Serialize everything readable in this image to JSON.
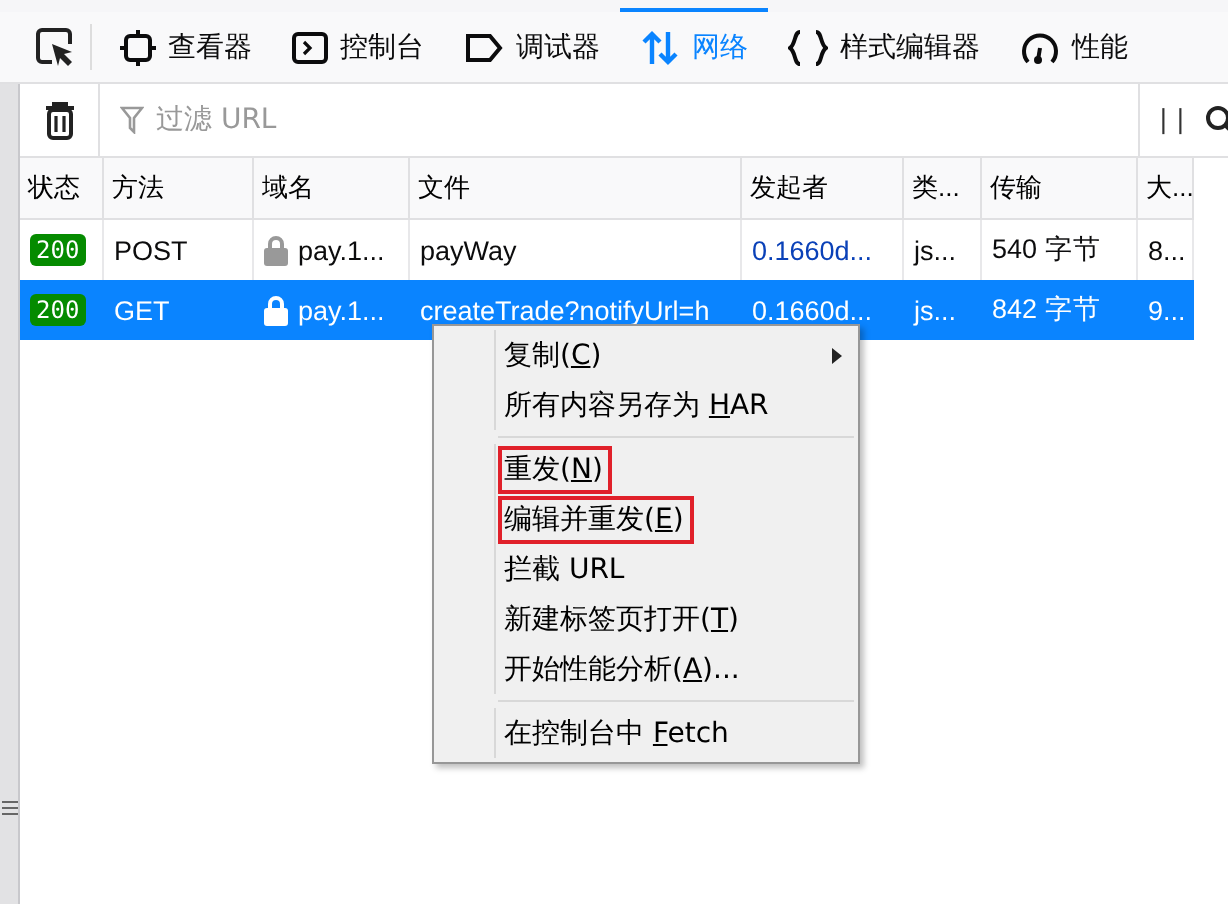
{
  "tabs": [
    {
      "label": "查看器",
      "selected": false
    },
    {
      "label": "控制台",
      "selected": false
    },
    {
      "label": "调试器",
      "selected": false
    },
    {
      "label": "网络",
      "selected": true
    },
    {
      "label": "样式编辑器",
      "selected": false
    },
    {
      "label": "性能",
      "selected": false
    }
  ],
  "filter": {
    "placeholder": "过滤 URL"
  },
  "pause_label": "| |",
  "table": {
    "columns": [
      "状态",
      "方法",
      "域名",
      "文件",
      "发起者",
      "类...",
      "传输",
      "大..."
    ],
    "rows": [
      {
        "status": "200",
        "method": "POST",
        "domain": "pay.1...",
        "file": "payWay",
        "initiator": "0.1660d...",
        "type": "js...",
        "transferred": "540 字节",
        "size": "8...",
        "selected": false
      },
      {
        "status": "200",
        "method": "GET",
        "domain": "pay.1...",
        "file": "createTrade?notifyUrl=h",
        "initiator": "0.1660d...",
        "type": "js...",
        "transferred": "842 字节",
        "size": "9...",
        "selected": true
      }
    ]
  },
  "context_menu": [
    {
      "kind": "item",
      "before": "复制(",
      "accel": "C",
      "after": ")",
      "submenu": true,
      "highlighted": false
    },
    {
      "kind": "item",
      "before": "所有内容另存为 ",
      "accel": "H",
      "after": "AR",
      "submenu": false,
      "highlighted": false
    },
    {
      "kind": "separator"
    },
    {
      "kind": "item",
      "before": "重发(",
      "accel": "N",
      "after": ")",
      "submenu": false,
      "highlighted": true
    },
    {
      "kind": "item",
      "before": "编辑并重发(",
      "accel": "E",
      "after": ")",
      "submenu": false,
      "highlighted": true
    },
    {
      "kind": "item",
      "before": "拦截 URL",
      "submenu": false,
      "highlighted": false
    },
    {
      "kind": "item",
      "before": "新建标签页打开(",
      "accel": "T",
      "after": ")",
      "submenu": false,
      "highlighted": false
    },
    {
      "kind": "item",
      "before": "开始性能分析(",
      "accel": "A",
      "after": ")...",
      "submenu": false,
      "highlighted": false
    },
    {
      "kind": "separator"
    },
    {
      "kind": "item",
      "before": "在控制台中 ",
      "accel": "F",
      "after": "etch",
      "submenu": false,
      "highlighted": false
    }
  ]
}
